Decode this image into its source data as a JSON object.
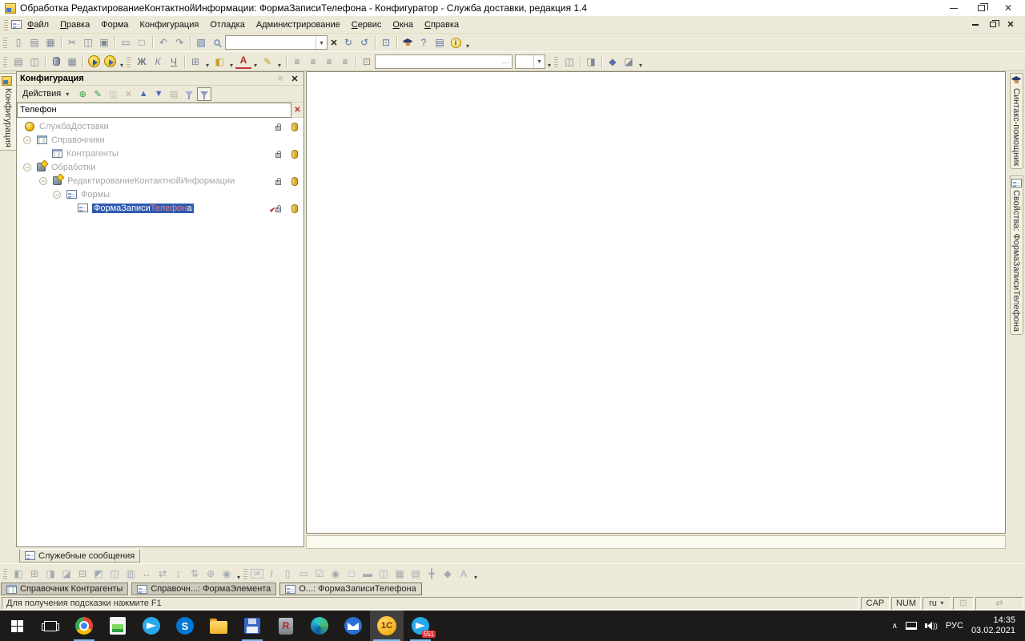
{
  "colors": {
    "selection": "#2f5ab0",
    "search_match_red": "#e05c5c",
    "chrome_beige": "#ece9d8",
    "taskbar_dark": "#1c1b1a",
    "tree_text_gray": "#a6a6a6"
  },
  "glyphs": {
    "close": "✕",
    "dd": "▾",
    "collapse": "−",
    "new": "▯",
    "open": "▤",
    "save": "▦",
    "cut": "✂",
    "copy": "◫",
    "paste": "▣",
    "print": "▭",
    "preview": "□",
    "undo": "↶",
    "redo": "↷",
    "find_global": "▧",
    "find_next": "↻",
    "find_prev": "↺",
    "copy_pages": "⊡",
    "help_q": "?",
    "book": "▤",
    "info_i": "i",
    "cfg_open": "▤",
    "cfg_db": "◫",
    "db_table": "▦",
    "bold": "Ж",
    "italic": "К",
    "underline": "Ч",
    "borders": "⊞",
    "fill": "◧",
    "font_color": "А",
    "marker": "✎",
    "align": "≡",
    "grid": "⊡",
    "ellipsis": "…",
    "win_split1": "◫",
    "win_split2": "◨",
    "wand": "◆",
    "check_doc": "◪",
    "act_add": "⊕",
    "act_edit": "✎",
    "act_copy": "◫",
    "act_del": "✕",
    "act_up": "▲",
    "act_down": "▼",
    "act_sort": "▤",
    "sb1": "⊡",
    "sb2": "⇄",
    "sel_check": "✔"
  },
  "titlebar": {
    "title": "Обработка РедактированиеКонтактнойИнформации: ФормаЗаписиТелефона - Конфигуратор - Служба доставки, редакция 1.4"
  },
  "menu": {
    "items": [
      {
        "u": "Ф",
        "rest": "айл"
      },
      {
        "u": "П",
        "rest": "равка"
      },
      {
        "u": "",
        "rest": "Форма"
      },
      {
        "u": "",
        "rest": "Конфигурация"
      },
      {
        "u": "",
        "rest": "Отладка"
      },
      {
        "u": "",
        "rest": "Администрирование"
      },
      {
        "u": "С",
        "rest": "ервис"
      },
      {
        "u": "О",
        "rest": "кна"
      },
      {
        "u": "С",
        "rest": "правка"
      }
    ]
  },
  "config_panel": {
    "title": "Конфигурация",
    "actions_label": "Действия",
    "search_value": "Телефон",
    "tree": [
      {
        "label": "СлужбаДоставки"
      },
      {
        "label": "Справочники"
      },
      {
        "label": "Контрагенты"
      },
      {
        "label": "Обработки"
      },
      {
        "label": "РедактированиеКонтактнойИнформации"
      },
      {
        "label": "Формы"
      },
      {
        "prefix": "ФормаЗаписи",
        "match": "Телефон",
        "suffix": "а"
      }
    ]
  },
  "side_tabs": {
    "left": "Конфигурация",
    "right_syntax": "Синтакс-помощник",
    "right_props": "Свойства: ФормаЗаписиТелефона"
  },
  "service_tab": {
    "label": "Служебные сообщения"
  },
  "window_tabs": [
    {
      "label": "Справочник Контрагенты"
    },
    {
      "label": "Справочн...: ФормаЭлемента"
    },
    {
      "label": "О...: ФормаЗаписиТелефона"
    }
  ],
  "status": {
    "hint": "Для получения подсказки нажмите F1",
    "cap": "CAP",
    "num": "NUM",
    "lang": "ru"
  },
  "taskbar": {
    "onec": "1С",
    "skype": "S",
    "r_app": "R",
    "badge": "551",
    "tray_lang": "РУС",
    "time": "14:35",
    "date": "03.02.2021"
  },
  "b3a": [
    "◧",
    "⊞",
    "◨",
    "◪",
    "⊟",
    "◩",
    "◫",
    "▥",
    "↔",
    "⇄",
    "↕",
    "⇅",
    "⊕",
    "◉"
  ],
  "b3b": [
    "ok",
    "I",
    "▯",
    "▭",
    "☑",
    "◉",
    "□",
    "▬",
    "◫",
    "▦",
    "▤",
    "╋",
    "◆",
    "А"
  ]
}
